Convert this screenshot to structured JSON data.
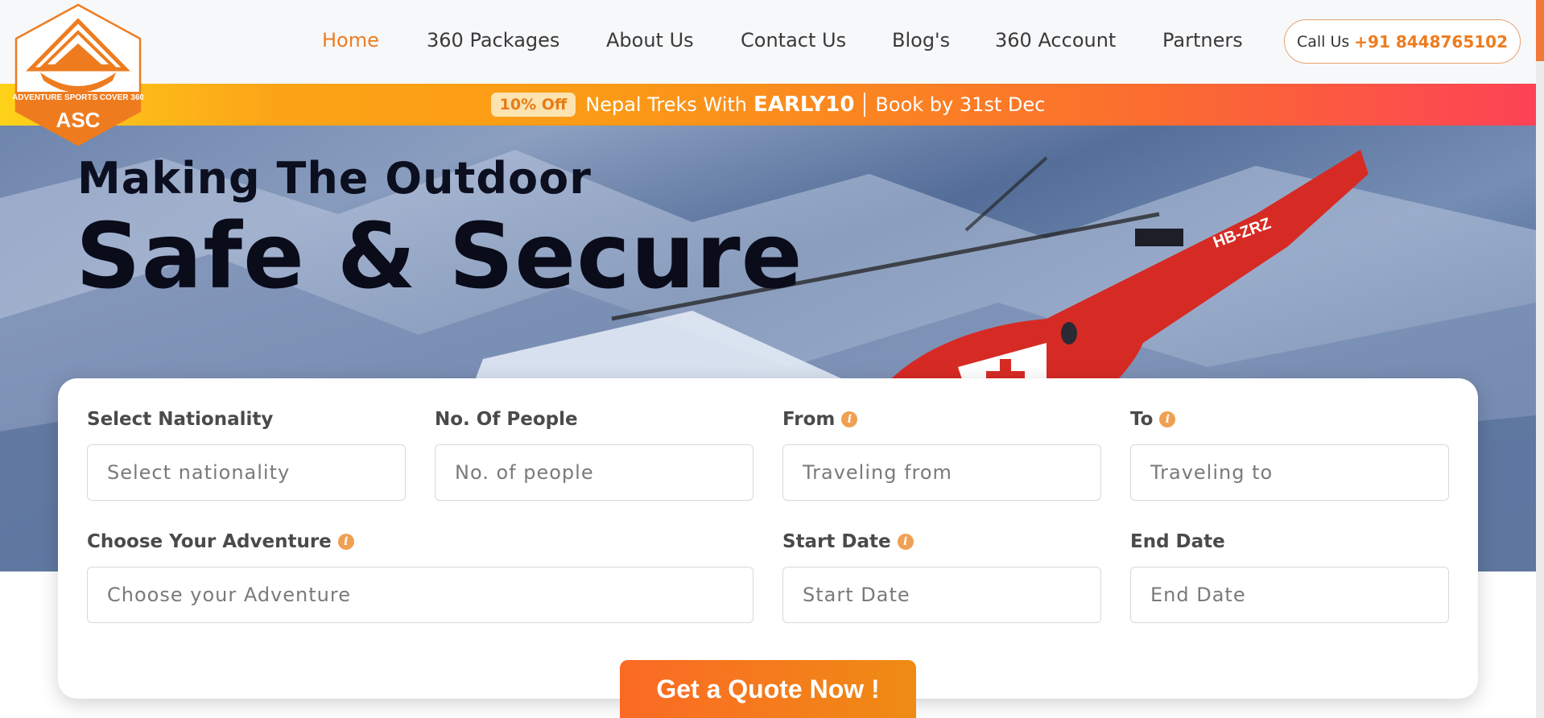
{
  "header": {
    "nav": [
      {
        "label": "Home",
        "active": true
      },
      {
        "label": "360 Packages"
      },
      {
        "label": "About Us"
      },
      {
        "label": "Contact Us"
      },
      {
        "label": "Blog's"
      },
      {
        "label": "360 Account"
      },
      {
        "label": "Partners"
      }
    ],
    "call": {
      "prefix": "Call Us",
      "number": "+91 8448765102"
    }
  },
  "logo": {
    "tagline": "ADVENTURE SPORTS COVER 360",
    "wordmark": "ASC"
  },
  "promo": {
    "badge": "10% Off",
    "text": "Nepal Treks With",
    "code": "EARLY10",
    "deadline": "Book by 31st Dec"
  },
  "hero": {
    "subtitle": "Making The Outdoor",
    "title": "Safe & Secure",
    "helicopter_reg": "HB-ZRZ"
  },
  "form": {
    "nationality": {
      "label": "Select Nationality",
      "placeholder": "Select nationality"
    },
    "people": {
      "label": "No. Of People",
      "placeholder": "No. of people"
    },
    "from": {
      "label": "From",
      "placeholder": "Traveling from"
    },
    "to": {
      "label": "To",
      "placeholder": "Traveling to"
    },
    "adventure": {
      "label": "Choose Your Adventure",
      "placeholder": "Choose your Adventure"
    },
    "start": {
      "label": "Start Date",
      "placeholder": "Start Date"
    },
    "end": {
      "label": "End Date",
      "placeholder": "End Date"
    },
    "submit": "Get a Quote Now !"
  },
  "colors": {
    "brand_orange": "#ee7c1f",
    "promo_start": "#ffd21a",
    "promo_end": "#fc4256"
  }
}
